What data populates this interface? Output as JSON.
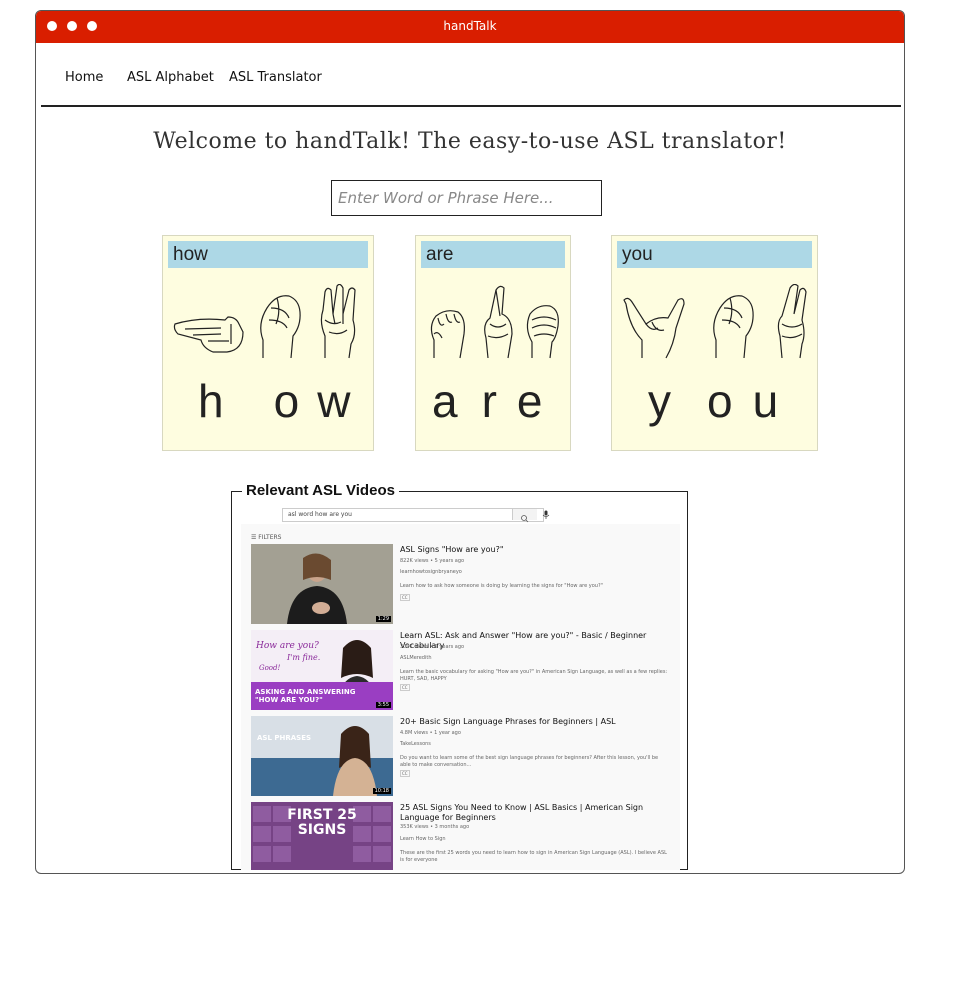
{
  "window": {
    "title": "handTalk"
  },
  "nav": {
    "items": [
      "Home",
      "ASL Alphabet",
      "ASL Translator"
    ]
  },
  "headline": "Welcome to handTalk! The easy-to-use ASL translator!",
  "search": {
    "placeholder": "Enter Word or Phrase Here...",
    "value": ""
  },
  "words": [
    {
      "word": "how",
      "letters": [
        "h",
        "o",
        "w"
      ]
    },
    {
      "word": "are",
      "letters": [
        "a",
        "r",
        "e"
      ]
    },
    {
      "word": "you",
      "letters": [
        "y",
        "o",
        "u"
      ]
    }
  ],
  "videos_section": {
    "legend": "Relevant ASL Videos",
    "query": "asl word how are you",
    "filters_label": "FILTERS",
    "videos": [
      {
        "title": "ASL Signs \"How are you?\"",
        "meta": "822K views • 5 years ago",
        "channel": "learnhowtosignbryaneyo",
        "desc": "Learn how to ask how someone is doing by learning the signs for \"How are you?\"",
        "duration": "1:29",
        "thumb_text": ""
      },
      {
        "title": "Learn ASL: Ask and Answer \"How are you?\" - Basic / Beginner Vocabulary",
        "meta": "309K views • 2 years ago",
        "channel": "ASLMeredith",
        "desc": "Learn the basic vocabulary for asking \"How are you?\" in American Sign Language, as well as a few replies: HURT, SAD, HAPPY",
        "duration": "3:55",
        "thumb_text": "ASKING AND ANSWERING \"HOW ARE YOU?\""
      },
      {
        "title": "20+ Basic Sign Language Phrases for Beginners | ASL",
        "meta": "4.8M views • 1 year ago",
        "channel": "TakeLessons",
        "desc": "Do you want to learn some of the best sign language phrases for beginners? After this lesson, you'll be able to make conversation...",
        "duration": "10:18",
        "thumb_text": "ASL PHRASES"
      },
      {
        "title": "25 ASL Signs You Need to Know | ASL Basics | American Sign Language for Beginners",
        "meta": "353K views • 3 months ago",
        "channel": "Learn How to Sign",
        "desc": "These are the first 25 words you need to learn how to sign in American Sign Language (ASL). I believe ASL is for everyone",
        "duration": "",
        "thumb_text": "FIRST 25 SIGNS"
      }
    ]
  },
  "colors": {
    "titlebar": "#d91e00",
    "card_bg": "#fefde0",
    "label_bg": "#add8e6"
  }
}
